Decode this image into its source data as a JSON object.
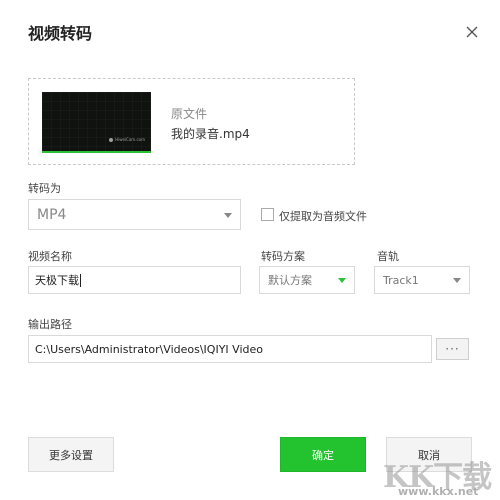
{
  "dialog": {
    "title": "视频转码",
    "close_icon": "close-icon"
  },
  "source": {
    "label": "原文件",
    "filename": "我的录音.mp4",
    "thumbnail_watermark": "HiweiCam.com"
  },
  "format": {
    "label": "转码为",
    "value": "MP4",
    "extract_audio_label": "仅提取为音频文件",
    "extract_audio_checked": false
  },
  "video_name": {
    "label": "视频名称",
    "value": "天极下载"
  },
  "scheme": {
    "label": "转码方案",
    "value": "默认方案",
    "accent": "#2cc33b"
  },
  "audio_track": {
    "label": "音轨",
    "value": "Track1"
  },
  "output": {
    "label": "输出路径",
    "path": "C:\\Users\\Administrator\\Videos\\IQIYI Video",
    "browse_label": "···"
  },
  "footer": {
    "more_settings": "更多设置",
    "confirm": "确定",
    "cancel": "取消"
  },
  "watermark": {
    "brand": "KK下载",
    "url": "www.kkx.net"
  },
  "colors": {
    "primary_green": "#22c32e"
  }
}
